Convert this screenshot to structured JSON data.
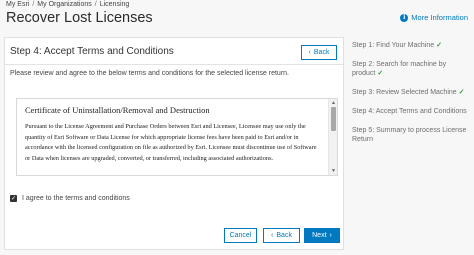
{
  "breadcrumb": [
    "My Esri",
    "My Organizations",
    "Licensing"
  ],
  "page_title": "Recover Lost Licenses",
  "more_info_label": "More Information",
  "step": {
    "heading": "Step 4: Accept Terms and Conditions",
    "back_top_label": "Back",
    "instructions": "Please review and agree to the below terms and conditions for the selected license return."
  },
  "terms": {
    "title": "Certificate of Uninstallation/Removal and Destruction",
    "body": "Pursuant to the License Agreement and Purchase Orders between Esri and Licensee, Licensee may use only the quantity of Esri Software or Data License for which appropriate license fees have been paid to Esri and/or in accordance with the licensed configuration on file as authorized by Esri. Licensee must discontinue use of Software or Data when licenses are upgraded, converted, or transferred, including associated authorizations."
  },
  "agree_label": "I agree to the terms and conditions",
  "agree_checked": true,
  "buttons": {
    "cancel": "Cancel",
    "back": "Back",
    "next": "Next"
  },
  "steps": [
    {
      "label": "Step 1: Find Your Machine",
      "done": true
    },
    {
      "label": "Step 2: Search for machine by product",
      "done": true
    },
    {
      "label": "Step 3: Review Selected Machine",
      "done": true
    },
    {
      "label": "Step 4: Accept Terms and Conditions",
      "done": false
    },
    {
      "label": "Step 5: Summary to process License Return",
      "done": false
    }
  ],
  "colors": {
    "accent": "#0079c1",
    "check": "#2f9a44"
  },
  "icons": {
    "more_info": "info-icon",
    "back": "chevron-left-icon",
    "next": "chevron-right-icon",
    "step_done": "check-icon"
  }
}
